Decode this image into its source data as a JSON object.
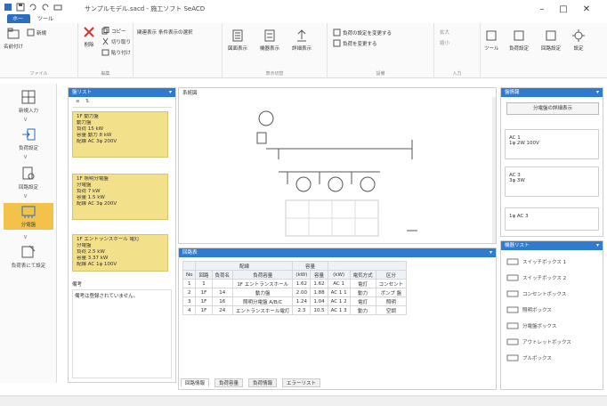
{
  "window": {
    "title": "サンプルモデル.sacd - 施工ソフト SeACD"
  },
  "tabs": [
    {
      "label": "ホーム"
    },
    {
      "label": "ツール"
    }
  ],
  "ribbon": {
    "groups": [
      {
        "label": "ファイル"
      },
      {
        "label": "編集"
      },
      {
        "label": "表示切替"
      },
      {
        "label": "設備"
      },
      {
        "label": "入力"
      }
    ],
    "buttons": {
      "open": "名前付け",
      "new": "新規",
      "delete": "削除",
      "copy": "コピー",
      "cut": "切り取り",
      "paste": "貼り付け",
      "ref_input": "関連表示",
      "kind": "条件表示の選択",
      "sym1": "図面表示",
      "sym2": "機器表示",
      "sym3": "詳細表示",
      "check1": "負荷の設定を変更する",
      "check2": "負荷を変更する",
      "zoom_in": "拡大",
      "zoom_out": "縮小",
      "b1": "ツール",
      "b2": "負荷設定",
      "b3": "回路設定",
      "b4": "設定"
    }
  },
  "leftnav": [
    {
      "label": "新規入力"
    },
    {
      "label": "負荷設定"
    },
    {
      "label": "回路設定"
    },
    {
      "label": "分電盤"
    },
    {
      "label": "負荷表にて設定"
    }
  ],
  "list_panel": {
    "title": "盤リスト",
    "cards": [
      {
        "lines": [
          "1F 動力盤",
          "動力盤",
          "負荷 15 kW",
          "容量 動力 8 kW",
          "配線 AC 3φ 200V"
        ]
      },
      {
        "lines": [
          "1F 照明分電盤",
          "分電盤",
          "負荷 7 kW",
          "容量 1.5 kW",
          "配線 AC 3φ 200V"
        ]
      },
      {
        "lines": [
          "1F エントランスホール 電灯",
          "分電盤",
          "負荷 2.5 kW",
          "容量 3.37 kW",
          "配線 AC 1φ 100V"
        ]
      }
    ],
    "note_label": "備考",
    "note_text": "備考は登録されていません。"
  },
  "diagram": {
    "title": "系統図"
  },
  "table_panel": {
    "title": "回路表",
    "col_group1": "配線",
    "col_group2": "容量",
    "headers": [
      "No",
      "回路",
      "負荷名",
      "負荷容量",
      "(kW)",
      "容量",
      "(kW)",
      "電気方式",
      "区分"
    ],
    "rows": [
      [
        "1",
        "1",
        "",
        "1F エントランスホール",
        "1.62",
        "1.62",
        "AC 1",
        "電灯",
        "コンセント"
      ],
      [
        "2",
        "1F",
        "14",
        "動力盤",
        "2.00",
        "1.88",
        "AC 1 1",
        "動力",
        "ポンプ 盤"
      ],
      [
        "3",
        "1F",
        "16",
        "照明分電盤 A/B/C",
        "1.24",
        "1.04",
        "AC 1 2",
        "電灯",
        "照明"
      ],
      [
        "4",
        "1F",
        "24",
        "エントランスホール電灯",
        "2.3",
        "10.5",
        "AC 1 3",
        "動力",
        "空調"
      ]
    ],
    "bottom_tabs": [
      "回路情報",
      "負荷容量",
      "負荷情報",
      "エラーリスト"
    ]
  },
  "right_panel": {
    "title": "盤情報",
    "button": "分電盤の詳細表示",
    "cards": [
      {
        "lines": [
          "AC 1",
          "1φ 2W 100V"
        ]
      },
      {
        "lines": [
          "AC 3",
          "3φ 3W"
        ]
      },
      {
        "lines": [
          "1φ AC 3"
        ]
      }
    ]
  },
  "catalog_panel": {
    "title": "機器リスト",
    "items": [
      {
        "label": "スイッチボックス 1"
      },
      {
        "label": "スイッチボックス 2"
      },
      {
        "label": "コンセントボックス"
      },
      {
        "label": "照明ボックス"
      },
      {
        "label": "分電盤ボックス"
      },
      {
        "label": "アウトレットボックス"
      },
      {
        "label": "プルボックス"
      }
    ]
  },
  "colors": {
    "accent": "#2f7bd0",
    "card": "#f3e08a",
    "nav_icon": "#2b6dbf"
  }
}
